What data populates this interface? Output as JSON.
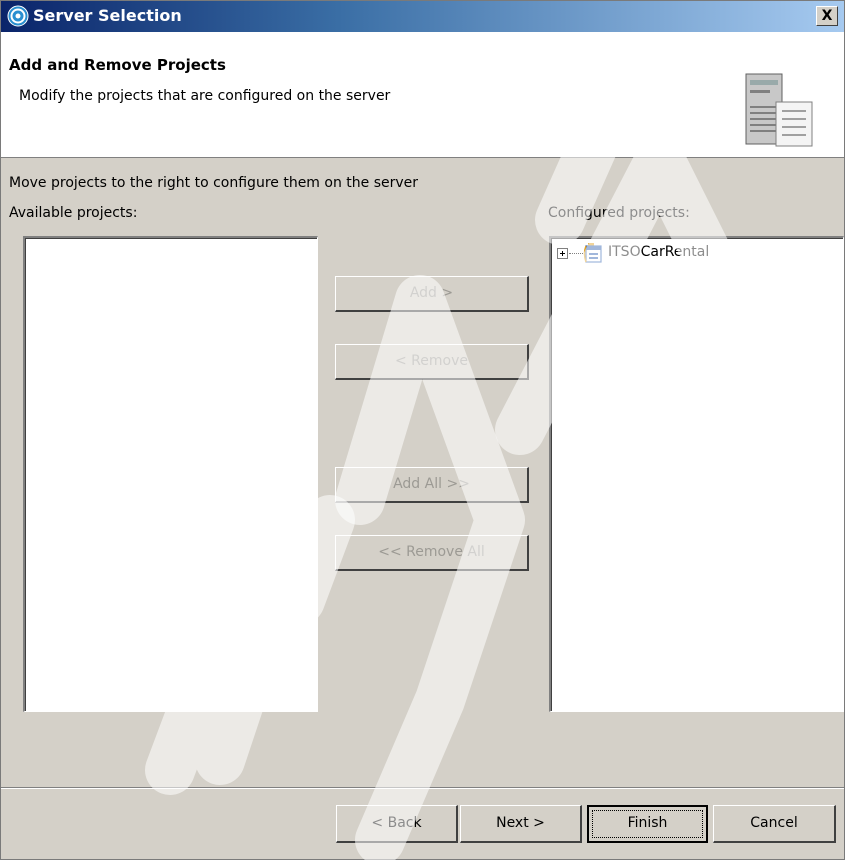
{
  "window": {
    "title": "Server Selection",
    "close_label": "X"
  },
  "header": {
    "title": "Add and Remove Projects",
    "description": "Modify the projects that are configured on the server"
  },
  "instruction": "Move projects to the right to configure them on the server",
  "available": {
    "label": "Available projects:",
    "items": []
  },
  "configured": {
    "label": "Configured projects:",
    "items": [
      {
        "label": "ITSOCarRental"
      }
    ]
  },
  "transfer_buttons": {
    "add": "Add >",
    "remove": "< Remove",
    "add_all": "Add All >>",
    "remove_all": "<< Remove All"
  },
  "footer": {
    "back": "< Back",
    "next": "Next >",
    "finish": "Finish",
    "cancel": "Cancel"
  },
  "colors": {
    "titlebar_start": "#0a246a",
    "titlebar_end": "#a6caf0",
    "dialog_bg": "#d4d0c8",
    "disabled_text": "#9c9a94"
  }
}
